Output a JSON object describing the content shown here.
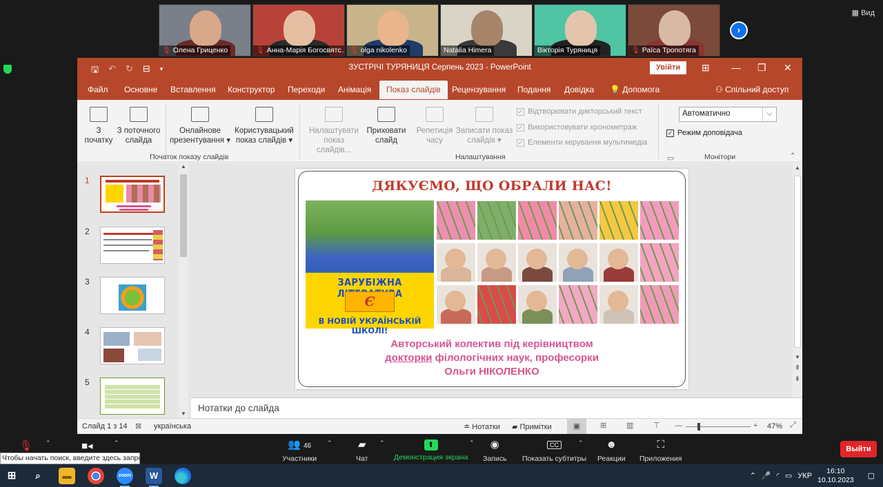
{
  "zoom": {
    "view_label": "Вид",
    "participants": [
      {
        "name": "Олена Гриценко",
        "muted": true,
        "bg": "#7a7f8a",
        "face": "#d9a88b",
        "body": "#6b2a2a"
      },
      {
        "name": "Анна-Марія Богосвятс...",
        "muted": true,
        "bg": "#b8423a",
        "face": "#e6bfa3",
        "body": "#2a2a2a"
      },
      {
        "name": "olga nikolenko",
        "muted": true,
        "bg": "#c7b48b",
        "face": "#eab58c",
        "body": "#1f3c6a"
      },
      {
        "name": "Natalia Himera",
        "muted": false,
        "bg": "#d9d4c6",
        "face": "#a7856a",
        "body": "#3a3a3a"
      },
      {
        "name": "Вікторія Туряниця",
        "muted": false,
        "bg": "#4fc5a3",
        "face": "#e3c5ad",
        "body": "#222"
      },
      {
        "name": "Раїса Тропотяга",
        "muted": true,
        "bg": "#7b4a3a",
        "face": "#d8b9a5",
        "body": "#8a3434"
      }
    ],
    "controls": {
      "participants_label": "Участники",
      "participants_count": "46",
      "chat_label": "Чат",
      "share_label": "Демонстрация экрана",
      "record_label": "Запись",
      "captions_label": "Показать субтитры",
      "reactions_label": "Реакции",
      "apps_label": "Приложения",
      "captions_icon_text": "CC",
      "leave_label": "Выйти"
    }
  },
  "ppt": {
    "title": "ЗУСТРІЧІ ТУРЯНИЦЯ Серпень 2023  -  PowerPoint",
    "signin_label": "Увійти",
    "tabs": [
      "Файл",
      "Основне",
      "Вставлення",
      "Конструктор",
      "Переходи",
      "Анімація",
      "Показ слайдів",
      "Рецензування",
      "Подання",
      "Довідка",
      "Допомога"
    ],
    "active_tab": "Показ слайдів",
    "share_label": "Спільний доступ",
    "ribbon": {
      "from_start": [
        "З",
        "початку"
      ],
      "from_current": [
        "З поточного",
        "слайда"
      ],
      "online": [
        "Онлайнове",
        "презентування ▾"
      ],
      "custom": [
        "Користувацький",
        "показ слайдів ▾"
      ],
      "group_start": "Початок показу слайдів",
      "setup": [
        "Налаштувати",
        "показ слайдів..."
      ],
      "hide": [
        "Приховати",
        "слайд"
      ],
      "rehearse": [
        "Репетиція",
        "часу"
      ],
      "record": [
        "Записати показ",
        "слайдів ▾"
      ],
      "chk_narration": "Відтворювати дикторський текст",
      "chk_timings": "Використовувати хронометраж",
      "chk_media": "Елементи керування мультимедіа",
      "group_setup": "Налаштування",
      "monitor_value": "Автоматично",
      "presenter_view": "Режим доповідача",
      "group_monitors": "Монітори"
    },
    "slide": {
      "heading": "ДЯКУЄМО, ЩО ОБРАЛИ НАС!",
      "banner_line1": "ЗАРУБІЖНА ЛІТЕРАТУРА",
      "banner_mid": "Є",
      "banner_line2": "В НОВІЙ УКРАЇНСЬКІЙ ШКОЛІ!",
      "caption1": "Авторський колектив під керівництвом",
      "caption2_underlined": "докторки",
      "caption2_rest": " філологічних наук, професорки",
      "caption3": "Ольги НІКОЛЕНКО"
    },
    "thumbnails": [
      "1",
      "2",
      "3",
      "4",
      "5"
    ],
    "notes_placeholder": "Нотатки до слайда",
    "status": {
      "slide_of": "Слайд 1 з 14",
      "language": "українська",
      "notes": "Нотатки",
      "comments": "Примітки",
      "zoom": "47%"
    }
  },
  "windows": {
    "search_tip": "Чтобы начать поиск, введите здесь запрос",
    "lang": "УКР",
    "time": "16:10",
    "date": "10.10.2023"
  }
}
